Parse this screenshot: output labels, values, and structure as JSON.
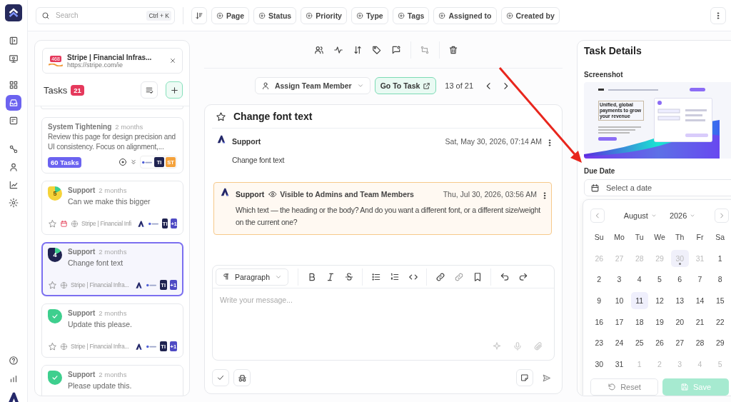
{
  "nav": {
    "groups": [
      [
        {
          "selected": false
        },
        {
          "selected": false
        }
      ],
      [
        {
          "selected": false
        },
        {
          "selected": true
        },
        {
          "selected": false
        }
      ],
      [
        {
          "selected": false
        },
        {
          "selected": false
        },
        {
          "selected": false
        },
        {
          "selected": false
        }
      ]
    ],
    "footer": [
      {
        "selected": false
      },
      {
        "selected": false
      }
    ]
  },
  "toolbar": {
    "search": {
      "placeholder": "Search",
      "shortcut": "Ctrl + K"
    },
    "filters": [
      "Page",
      "Status",
      "Priority",
      "Type",
      "Tags",
      "Assigned to",
      "Created by"
    ]
  },
  "tasks_panel": {
    "source": {
      "badge": "468",
      "title": "Stripe | Financial Infras...",
      "url": "https://stripe.com/ie"
    },
    "title": "Tasks",
    "count": "21",
    "cards": [
      {
        "kind": "epic",
        "title": "System Tightening",
        "age": "2 months",
        "text": "Review this page for design precision and UI consistency. Focus on alignment,...",
        "count": "60 Tasks",
        "assignees": [
          {
            "initials": "TI",
            "color": "#1f2350"
          },
          {
            "initials": "ST",
            "color": "#f4a23c"
          }
        ]
      },
      {
        "kind": "task",
        "badge": {
          "kind": "progress",
          "number": "5"
        },
        "author": "Support",
        "age": "2 months",
        "text": "Can we make this bigger",
        "starred": false,
        "due": true,
        "site": "Stripe | Financial Infi",
        "assignees": [
          {
            "initials": "TI",
            "color": "#1f2350"
          },
          {
            "initials": "+1",
            "color": "#4f4bc4"
          }
        ],
        "selected": false
      },
      {
        "kind": "task",
        "badge": {
          "kind": "review",
          "number": "4"
        },
        "author": "Support",
        "age": "2 months",
        "text": "Change font text",
        "starred": false,
        "due": false,
        "site": "Stripe | Financial Infra...",
        "assignees": [
          {
            "initials": "TI",
            "color": "#1f2350"
          },
          {
            "initials": "+1",
            "color": "#4f4bc4"
          }
        ],
        "selected": true
      },
      {
        "kind": "task",
        "badge": {
          "kind": "done"
        },
        "author": "Support",
        "age": "2 months",
        "text": "Update this please.",
        "starred": false,
        "due": false,
        "site": "Stripe | Financial Infra...",
        "assignees": [
          {
            "initials": "TI",
            "color": "#1f2350"
          },
          {
            "initials": "+1",
            "color": "#4f4bc4"
          }
        ],
        "selected": false
      },
      {
        "kind": "task",
        "badge": {
          "kind": "done"
        },
        "author": "Support",
        "age": "2 months",
        "text": "Please update this.",
        "selected": false
      }
    ]
  },
  "task_view": {
    "assign": "Assign Team Member",
    "go_to": "Go To Task",
    "pager": "13 of 21",
    "title": "Change font text",
    "starred": false,
    "comments": [
      {
        "author": "Support",
        "time": "Sat, May 30, 2026, 07:14 AM",
        "text": "Change font text",
        "internal": false
      },
      {
        "author": "Support",
        "visibility": "Visible to Admins and Team Members",
        "time": "Thu, Jul 30, 2026, 03:56 AM",
        "text": "Which text — the heading or the body? And do you want a different font, or a different size/weight on the current one?",
        "internal": true
      }
    ],
    "editor": {
      "block_style": "Paragraph",
      "placeholder": "Write your message..."
    }
  },
  "details": {
    "title": "Task Details",
    "screenshot_label": "Screenshot",
    "screenshot_headline": "Unified, global payments to grow your revenue",
    "due_label": "Due Date",
    "due_placeholder": "Select a date",
    "calendar": {
      "month": "August",
      "year": "2026",
      "weekdays": [
        "Su",
        "Mo",
        "Tu",
        "We",
        "Th",
        "Fr",
        "Sa"
      ],
      "days": [
        {
          "label": "26",
          "outside": true,
          "today": false,
          "selected": false
        },
        {
          "label": "27",
          "outside": true,
          "today": false,
          "selected": false
        },
        {
          "label": "28",
          "outside": true,
          "today": false,
          "selected": false
        },
        {
          "label": "29",
          "outside": true,
          "today": false,
          "selected": false
        },
        {
          "label": "30",
          "outside": true,
          "today": true,
          "selected": false
        },
        {
          "label": "31",
          "outside": true,
          "today": false,
          "selected": false
        },
        {
          "label": "1",
          "outside": false,
          "today": false,
          "selected": false
        },
        {
          "label": "2",
          "outside": false,
          "today": false,
          "selected": false
        },
        {
          "label": "3",
          "outside": false,
          "today": false,
          "selected": false
        },
        {
          "label": "4",
          "outside": false,
          "today": false,
          "selected": false
        },
        {
          "label": "5",
          "outside": false,
          "today": false,
          "selected": false
        },
        {
          "label": "6",
          "outside": false,
          "today": false,
          "selected": false
        },
        {
          "label": "7",
          "outside": false,
          "today": false,
          "selected": false
        },
        {
          "label": "8",
          "outside": false,
          "today": false,
          "selected": false
        },
        {
          "label": "9",
          "outside": false,
          "today": false,
          "selected": false
        },
        {
          "label": "10",
          "outside": false,
          "today": false,
          "selected": false
        },
        {
          "label": "11",
          "outside": false,
          "today": false,
          "selected": true
        },
        {
          "label": "12",
          "outside": false,
          "today": false,
          "selected": false
        },
        {
          "label": "13",
          "outside": false,
          "today": false,
          "selected": false
        },
        {
          "label": "14",
          "outside": false,
          "today": false,
          "selected": false
        },
        {
          "label": "15",
          "outside": false,
          "today": false,
          "selected": false
        },
        {
          "label": "16",
          "outside": false,
          "today": false,
          "selected": false
        },
        {
          "label": "17",
          "outside": false,
          "today": false,
          "selected": false
        },
        {
          "label": "18",
          "outside": false,
          "today": false,
          "selected": false
        },
        {
          "label": "19",
          "outside": false,
          "today": false,
          "selected": false
        },
        {
          "label": "20",
          "outside": false,
          "today": false,
          "selected": false
        },
        {
          "label": "21",
          "outside": false,
          "today": false,
          "selected": false
        },
        {
          "label": "22",
          "outside": false,
          "today": false,
          "selected": false
        },
        {
          "label": "23",
          "outside": false,
          "today": false,
          "selected": false
        },
        {
          "label": "24",
          "outside": false,
          "today": false,
          "selected": false
        },
        {
          "label": "25",
          "outside": false,
          "today": false,
          "selected": false
        },
        {
          "label": "26",
          "outside": false,
          "today": false,
          "selected": false
        },
        {
          "label": "27",
          "outside": false,
          "today": false,
          "selected": false
        },
        {
          "label": "28",
          "outside": false,
          "today": false,
          "selected": false
        },
        {
          "label": "29",
          "outside": false,
          "today": false,
          "selected": false
        },
        {
          "label": "30",
          "outside": false,
          "today": false,
          "selected": false
        },
        {
          "label": "31",
          "outside": false,
          "today": false,
          "selected": false
        },
        {
          "label": "1",
          "outside": true,
          "today": false,
          "selected": false
        },
        {
          "label": "2",
          "outside": true,
          "today": false,
          "selected": false
        },
        {
          "label": "3",
          "outside": true,
          "today": false,
          "selected": false
        },
        {
          "label": "4",
          "outside": true,
          "today": false,
          "selected": false
        },
        {
          "label": "5",
          "outside": true,
          "today": false,
          "selected": false
        }
      ],
      "reset": "Reset",
      "save": "Save",
      "save_disabled": true
    }
  }
}
